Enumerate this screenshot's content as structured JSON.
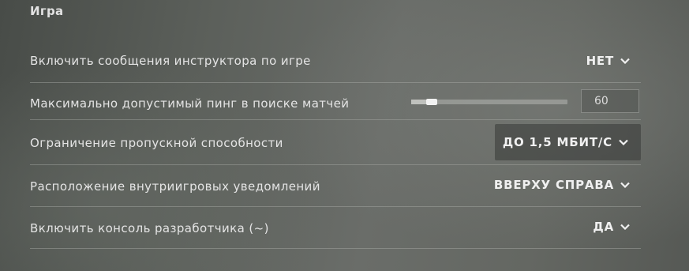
{
  "section": {
    "title": "Игра"
  },
  "settings": [
    {
      "label": "Включить сообщения инструктора по игре",
      "type": "dropdown",
      "value": "НЕТ"
    },
    {
      "label": "Максимально допустимый пинг в поиске матчей",
      "type": "slider",
      "value": "60",
      "slider_fraction": 0.13
    },
    {
      "label": "Ограничение пропускной способности",
      "type": "dropdown",
      "value": "ДО 1,5 МБИТ/С",
      "highlighted": true
    },
    {
      "label": "Расположение внутриигровых уведомлений",
      "type": "dropdown",
      "value": "ВВЕРХУ СПРАВА"
    },
    {
      "label": "Включить консоль разработчика (~)",
      "type": "dropdown",
      "value": "ДА"
    }
  ],
  "icons": {
    "dropdown_arrow": "chevron-down-icon"
  },
  "colors": {
    "text": "#e4e4e4",
    "divider": "#aaaca8",
    "slider_thumb": "#f2f2f2"
  }
}
